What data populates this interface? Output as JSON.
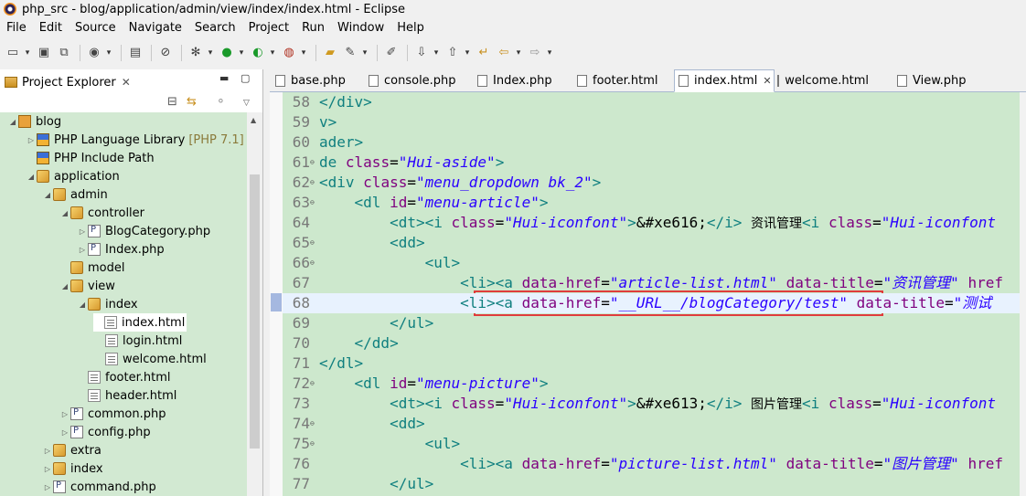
{
  "window": {
    "title": "php_src - blog/application/admin/view/index/index.html - Eclipse"
  },
  "menu": [
    "File",
    "Edit",
    "Source",
    "Navigate",
    "Search",
    "Project",
    "Run",
    "Window",
    "Help"
  ],
  "explorer": {
    "title": "Project Explorer",
    "close": "✕",
    "tree": [
      {
        "label": "blog",
        "icon": "proj",
        "depth": 0,
        "arrow": "◢"
      },
      {
        "label": "PHP Language Library",
        "extra": "[PHP 7.1]",
        "icon": "lib",
        "depth": 1,
        "arrow": "▷"
      },
      {
        "label": "PHP Include Path",
        "icon": "lib",
        "depth": 1,
        "arrow": ""
      },
      {
        "label": "application",
        "icon": "pkg",
        "depth": 1,
        "arrow": "◢"
      },
      {
        "label": "admin",
        "icon": "pkg",
        "depth": 2,
        "arrow": "◢"
      },
      {
        "label": "controller",
        "icon": "pkg",
        "depth": 3,
        "arrow": "◢"
      },
      {
        "label": "BlogCategory.php",
        "icon": "file",
        "depth": 4,
        "arrow": "▷"
      },
      {
        "label": "Index.php",
        "icon": "file",
        "depth": 4,
        "arrow": "▷"
      },
      {
        "label": "model",
        "icon": "pkg",
        "depth": 3,
        "arrow": ""
      },
      {
        "label": "view",
        "icon": "pkg",
        "depth": 3,
        "arrow": "◢"
      },
      {
        "label": "index",
        "icon": "pkg",
        "depth": 4,
        "arrow": "◢"
      },
      {
        "label": "index.html",
        "icon": "html",
        "depth": 5,
        "arrow": ""
      },
      {
        "label": "login.html",
        "icon": "html",
        "depth": 5,
        "arrow": ""
      },
      {
        "label": "welcome.html",
        "icon": "html",
        "depth": 5,
        "arrow": ""
      },
      {
        "label": "footer.html",
        "icon": "html",
        "depth": 4,
        "arrow": ""
      },
      {
        "label": "header.html",
        "icon": "html",
        "depth": 4,
        "arrow": ""
      },
      {
        "label": "common.php",
        "icon": "file",
        "depth": 3,
        "arrow": "▷"
      },
      {
        "label": "config.php",
        "icon": "file",
        "depth": 3,
        "arrow": "▷"
      },
      {
        "label": "extra",
        "icon": "pkg",
        "depth": 2,
        "arrow": "▷"
      },
      {
        "label": "index",
        "icon": "pkg",
        "depth": 2,
        "arrow": "▷"
      },
      {
        "label": "command.php",
        "icon": "file",
        "depth": 2,
        "arrow": "▷"
      }
    ]
  },
  "editor_tabs": [
    "base.php",
    "console.php",
    "Index.php",
    "footer.html",
    "index.html",
    "welcome.html",
    "View.php"
  ],
  "active_tab": "index.html",
  "code": [
    {
      "n": "58",
      "fold": "",
      "seg": [
        [
          "tag",
          "</div>"
        ]
      ]
    },
    {
      "n": "59",
      "fold": "",
      "seg": [
        [
          "tag",
          "v>"
        ]
      ]
    },
    {
      "n": "60",
      "fold": "",
      "seg": [
        [
          "tag",
          "ader>"
        ]
      ]
    },
    {
      "n": "61",
      "fold": "⊖",
      "seg": [
        [
          "tag",
          "de "
        ],
        [
          "attr",
          "class"
        ],
        [
          "txt",
          "="
        ],
        [
          "val",
          "\"Hui-aside\""
        ],
        [
          "tag",
          ">"
        ]
      ]
    },
    {
      "n": "62",
      "fold": "⊖",
      "seg": [
        [
          "tag",
          "<div "
        ],
        [
          "attr",
          "class"
        ],
        [
          "txt",
          "="
        ],
        [
          "val",
          "\"menu_dropdown bk_2\""
        ],
        [
          "tag",
          ">"
        ]
      ]
    },
    {
      "n": "63",
      "fold": "⊖",
      "seg": [
        [
          "txt",
          "    "
        ],
        [
          "tag",
          "<dl "
        ],
        [
          "attr",
          "id"
        ],
        [
          "txt",
          "="
        ],
        [
          "val",
          "\"menu-article\""
        ],
        [
          "tag",
          ">"
        ]
      ]
    },
    {
      "n": "64",
      "fold": "",
      "seg": [
        [
          "txt",
          "        "
        ],
        [
          "tag",
          "<dt><i "
        ],
        [
          "attr",
          "class"
        ],
        [
          "txt",
          "="
        ],
        [
          "val",
          "\"Hui-iconfont\""
        ],
        [
          "tag",
          ">"
        ],
        [
          "txt",
          "&#xe616;"
        ],
        [
          "tag",
          "</i>"
        ],
        [
          "txt",
          " "
        ],
        [
          "cn",
          "资讯管理"
        ],
        [
          "tag",
          "<i "
        ],
        [
          "attr",
          "class"
        ],
        [
          "txt",
          "="
        ],
        [
          "val",
          "\"Hui-iconfont"
        ]
      ]
    },
    {
      "n": "65",
      "fold": "⊖",
      "seg": [
        [
          "txt",
          "        "
        ],
        [
          "tag",
          "<dd>"
        ]
      ]
    },
    {
      "n": "66",
      "fold": "⊖",
      "seg": [
        [
          "txt",
          "            "
        ],
        [
          "tag",
          "<ul>"
        ]
      ]
    },
    {
      "n": "67",
      "fold": "",
      "seg": [
        [
          "txt",
          "                "
        ],
        [
          "tag",
          "<li><a "
        ],
        [
          "attr",
          "data-href"
        ],
        [
          "txt",
          "="
        ],
        [
          "val",
          "\"article-list.html\""
        ],
        [
          "txt",
          " "
        ],
        [
          "attr",
          "data-title"
        ],
        [
          "txt",
          "="
        ],
        [
          "val",
          "\"资讯管理\""
        ],
        [
          "txt",
          " "
        ],
        [
          "attr",
          "href"
        ]
      ]
    },
    {
      "n": "68",
      "fold": "",
      "seg": [
        [
          "txt",
          "                "
        ],
        [
          "tag",
          "<li><a "
        ],
        [
          "attr",
          "data-href"
        ],
        [
          "txt",
          "="
        ],
        [
          "val",
          "\"__URL__/blogCategory/test\""
        ],
        [
          "txt",
          " "
        ],
        [
          "attr",
          "data-title"
        ],
        [
          "txt",
          "="
        ],
        [
          "val",
          "\"测试"
        ]
      ]
    },
    {
      "n": "69",
      "fold": "",
      "seg": [
        [
          "txt",
          "        "
        ],
        [
          "tag",
          "</ul>"
        ]
      ]
    },
    {
      "n": "70",
      "fold": "",
      "seg": [
        [
          "txt",
          "    "
        ],
        [
          "tag",
          "</dd>"
        ]
      ]
    },
    {
      "n": "71",
      "fold": "",
      "seg": [
        [
          "tag",
          "</dl>"
        ]
      ]
    },
    {
      "n": "72",
      "fold": "⊖",
      "seg": [
        [
          "txt",
          "    "
        ],
        [
          "tag",
          "<dl "
        ],
        [
          "attr",
          "id"
        ],
        [
          "txt",
          "="
        ],
        [
          "val",
          "\"menu-picture\""
        ],
        [
          "tag",
          ">"
        ]
      ]
    },
    {
      "n": "73",
      "fold": "",
      "seg": [
        [
          "txt",
          "        "
        ],
        [
          "tag",
          "<dt><i "
        ],
        [
          "attr",
          "class"
        ],
        [
          "txt",
          "="
        ],
        [
          "val",
          "\"Hui-iconfont\""
        ],
        [
          "tag",
          ">"
        ],
        [
          "txt",
          "&#xe613;"
        ],
        [
          "tag",
          "</i>"
        ],
        [
          "txt",
          " "
        ],
        [
          "cn",
          "图片管理"
        ],
        [
          "tag",
          "<i "
        ],
        [
          "attr",
          "class"
        ],
        [
          "txt",
          "="
        ],
        [
          "val",
          "\"Hui-iconfont"
        ]
      ]
    },
    {
      "n": "74",
      "fold": "⊖",
      "seg": [
        [
          "txt",
          "        "
        ],
        [
          "tag",
          "<dd>"
        ]
      ]
    },
    {
      "n": "75",
      "fold": "⊖",
      "seg": [
        [
          "txt",
          "            "
        ],
        [
          "tag",
          "<ul>"
        ]
      ]
    },
    {
      "n": "76",
      "fold": "",
      "seg": [
        [
          "txt",
          "                "
        ],
        [
          "tag",
          "<li><a "
        ],
        [
          "attr",
          "data-href"
        ],
        [
          "txt",
          "="
        ],
        [
          "val",
          "\"picture-list.html\""
        ],
        [
          "txt",
          " "
        ],
        [
          "attr",
          "data-title"
        ],
        [
          "txt",
          "="
        ],
        [
          "val",
          "\"图片管理\""
        ],
        [
          "txt",
          " "
        ],
        [
          "attr",
          "href"
        ]
      ]
    },
    {
      "n": "77",
      "fold": "",
      "seg": [
        [
          "txt",
          "        "
        ],
        [
          "tag",
          "</ul>"
        ]
      ]
    }
  ],
  "highlighted_line": "68"
}
